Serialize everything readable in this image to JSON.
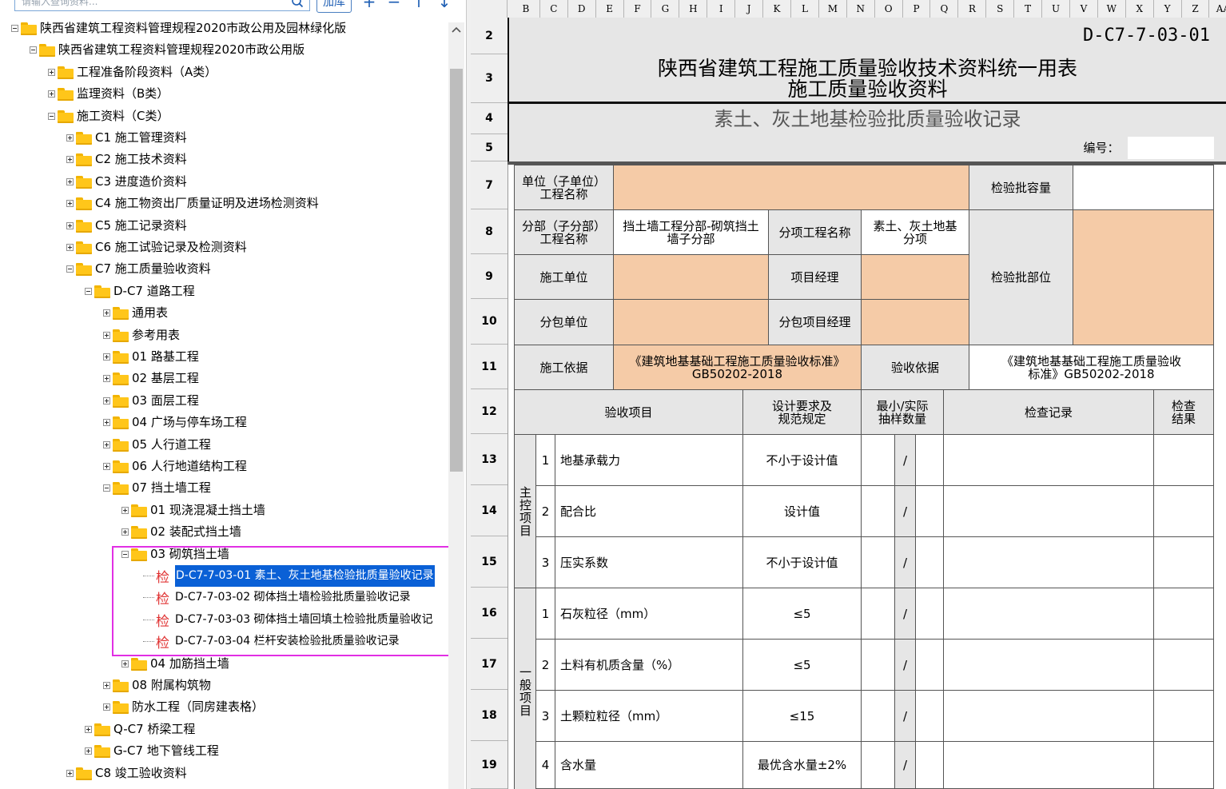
{
  "toolbar": {
    "search_placeholder": "请输入查询资料...",
    "add_library_label": "加库",
    "icon_add": "+",
    "icon_remove": "−",
    "icon_up": "↑",
    "icon_down": "↓"
  },
  "tree": [
    {
      "label": "陕西省建筑工程资料管理规程2020市政公用及园林绿化版",
      "level": 0,
      "state": "minus"
    },
    {
      "label": "陕西省建筑工程资料管理规程2020市政公用版",
      "level": 1,
      "state": "minus"
    },
    {
      "label": "工程准备阶段资料（A类）",
      "level": 2,
      "state": "plus"
    },
    {
      "label": "监理资料（B类）",
      "level": 2,
      "state": "plus"
    },
    {
      "label": "施工资料（C类）",
      "level": 2,
      "state": "minus"
    },
    {
      "label": "C1 施工管理资料",
      "level": 3,
      "state": "plus"
    },
    {
      "label": "C2 施工技术资料",
      "level": 3,
      "state": "plus"
    },
    {
      "label": "C3 进度造价资料",
      "level": 3,
      "state": "plus"
    },
    {
      "label": "C4 施工物资出厂质量证明及进场检测资料",
      "level": 3,
      "state": "plus"
    },
    {
      "label": "C5 施工记录资料",
      "level": 3,
      "state": "plus"
    },
    {
      "label": "C6 施工试验记录及检测资料",
      "level": 3,
      "state": "plus"
    },
    {
      "label": "C7 施工质量验收资料",
      "level": 3,
      "state": "minus"
    },
    {
      "label": "D-C7 道路工程",
      "level": 4,
      "state": "minus"
    },
    {
      "label": "通用表",
      "level": 5,
      "state": "plus"
    },
    {
      "label": "参考用表",
      "level": 5,
      "state": "plus"
    },
    {
      "label": "01 路基工程",
      "level": 5,
      "state": "plus"
    },
    {
      "label": "02 基层工程",
      "level": 5,
      "state": "plus"
    },
    {
      "label": "03 面层工程",
      "level": 5,
      "state": "plus"
    },
    {
      "label": "04 广场与停车场工程",
      "level": 5,
      "state": "plus"
    },
    {
      "label": "05 人行道工程",
      "level": 5,
      "state": "plus"
    },
    {
      "label": "06 人行地道结构工程",
      "level": 5,
      "state": "plus"
    },
    {
      "label": "07 挡土墙工程",
      "level": 5,
      "state": "minus"
    },
    {
      "label": "01 现浇混凝土挡土墙",
      "level": 6,
      "state": "plus"
    },
    {
      "label": "02 装配式挡土墙",
      "level": 6,
      "state": "plus"
    },
    {
      "label": "03 砌筑挡土墙",
      "level": 6,
      "state": "minus"
    },
    {
      "label": "D-C7-7-03-01 素土、灰土地基检验批质量验收记录",
      "level": 7,
      "state": "leaf",
      "selected": true
    },
    {
      "label": "D-C7-7-03-02 砌体挡土墙检验批质量验收记录",
      "level": 7,
      "state": "leaf"
    },
    {
      "label": "D-C7-7-03-03 砌体挡土墙回填土检验批质量验收记",
      "level": 7,
      "state": "leaf"
    },
    {
      "label": "D-C7-7-03-04 栏杆安装检验批质量验收记录",
      "level": 7,
      "state": "leaf"
    },
    {
      "label": "04 加筋挡土墙",
      "level": 6,
      "state": "plus"
    },
    {
      "label": "08 附属构筑物",
      "level": 5,
      "state": "plus"
    },
    {
      "label": "防水工程（同房建表格）",
      "level": 5,
      "state": "plus"
    },
    {
      "label": "Q-C7 桥梁工程",
      "level": 4,
      "state": "plus"
    },
    {
      "label": "G-C7 地下管线工程",
      "level": 4,
      "state": "plus"
    },
    {
      "label": "C8 竣工验收资料",
      "level": 3,
      "state": "plus"
    }
  ],
  "leaf_mark": "检",
  "sheet": {
    "columns": [
      "B",
      "C",
      "D",
      "E",
      "F",
      "G",
      "H",
      "I",
      "J",
      "K",
      "L",
      "M",
      "N",
      "O",
      "P",
      "Q",
      "R",
      "S",
      "T",
      "U",
      "V",
      "W",
      "X",
      "Y",
      "Z",
      "AA"
    ],
    "rows": [
      "2",
      "3",
      "4",
      "5",
      "7",
      "8",
      "9",
      "10",
      "11",
      "12",
      "13",
      "14",
      "15",
      "16",
      "17",
      "18",
      "19"
    ],
    "doc_code": "D-C7-7-03-01",
    "title_line1": "陕西省建筑工程施工质量验收技术资料统一用表",
    "title_line2": "施工质量验收资料",
    "subtitle": "素土、灰土地基检验批质量验收记录",
    "number_label": "编号：",
    "unit_name_label": "单位（子单位）\n工程名称",
    "batch_capacity_label": "检验批容量",
    "sub_division_label": "分部（子分部）\n工程名称",
    "sub_division_value": "挡土墙工程分部-砌筑挡土\n墙子分部",
    "sub_item_label": "分项工程名称",
    "sub_item_value": "素土、灰土地基\n分项",
    "contractor_label": "施工单位",
    "pm_label": "项目经理",
    "batch_part_label": "检验批部位",
    "subcontractor_label": "分包单位",
    "sub_pm_label": "分包项目经理",
    "construction_basis_label": "施工依据",
    "construction_basis_value": "《建筑地基基础工程施工质量验收标准》\nGB50202-2018",
    "acceptance_basis_label": "验收依据",
    "acceptance_basis_value": "《建筑地基基础工程施工质量验收\n标准》GB50202-2018",
    "hdr_item": "验收项目",
    "hdr_design": "设计要求及\n规范规定",
    "hdr_sample": "最小/实际\n抽样数量",
    "hdr_record": "检查记录",
    "hdr_result": "检查\n结果",
    "main_group": "主控项目",
    "general_group": "一般项目",
    "main_items": [
      {
        "no": "1",
        "name": "地基承载力",
        "req": "不小于设计值",
        "slash": "/"
      },
      {
        "no": "2",
        "name": "配合比",
        "req": "设计值",
        "slash": "/"
      },
      {
        "no": "3",
        "name": "压实系数",
        "req": "不小于设计值",
        "slash": "/"
      }
    ],
    "general_items": [
      {
        "no": "1",
        "name": "石灰粒径（mm）",
        "req": "≤5",
        "slash": "/"
      },
      {
        "no": "2",
        "name": "土料有机质含量（%）",
        "req": "≤5",
        "slash": "/"
      },
      {
        "no": "3",
        "name": "土颗粒粒径（mm）",
        "req": "≤15",
        "slash": "/"
      },
      {
        "no": "4",
        "name": "含水量",
        "req": "最优含水量±2%",
        "slash": "/"
      }
    ]
  }
}
